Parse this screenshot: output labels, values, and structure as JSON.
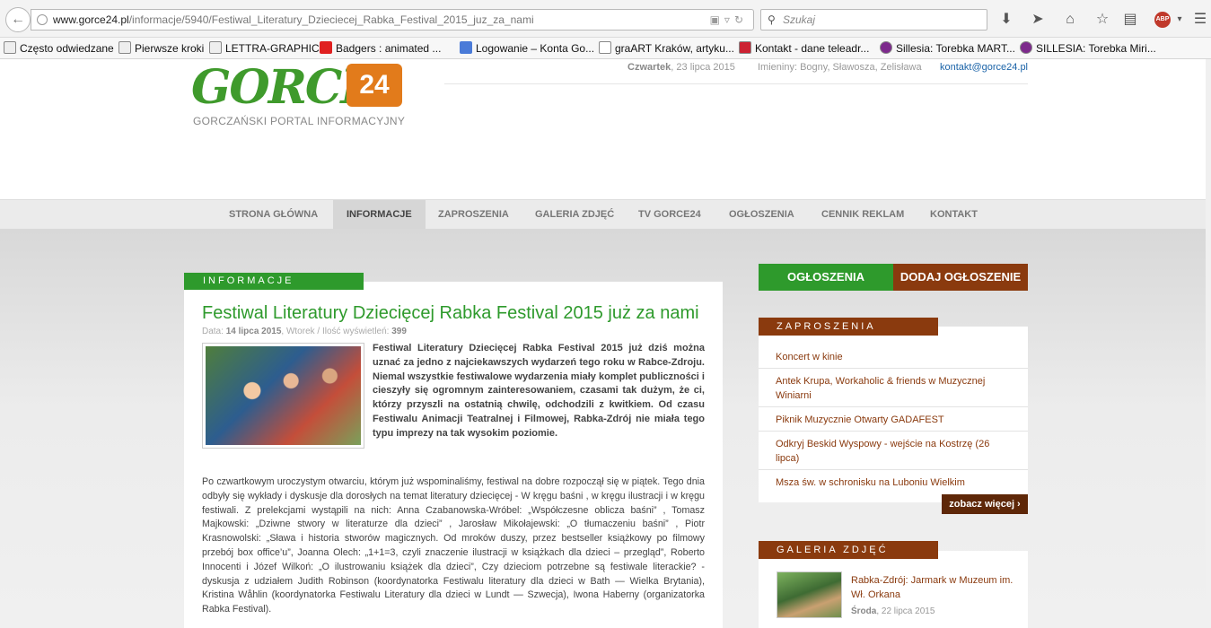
{
  "browser": {
    "url_host": "www.gorce24.pl",
    "url_path": "/informacje/5940/Festiwal_Literatury_Dzieciecej_Rabka_Festival_2015_juz_za_nami",
    "search_placeholder": "Szukaj",
    "abp_label": "ABP"
  },
  "bookmarks": [
    "Często odwiedzane",
    "Pierwsze kroki",
    "LETTRA-GRAPHIC",
    "Badgers : animated ...",
    "Logowanie – Konta Go...",
    "graART Kraków, artyku...",
    "Kontakt - dane teleadr...",
    "Sillesia: Torebka MART...",
    "SILLESIA: Torebka Miri..."
  ],
  "header": {
    "logo_word": "GORCE",
    "logo_badge": "24",
    "logo_tagline": "GORCZAŃSKI PORTAL INFORMACYJNY",
    "day": "Czwartek",
    "date": ", 23 lipca 2015",
    "nameday": "Imieniny: Bogny, Sławosza, Zelisława",
    "email": "kontakt@gorce24.pl"
  },
  "menu": [
    "STRONA GŁÓWNA",
    "INFORMACJE",
    "ZAPROSZENIA",
    "GALERIA ZDJĘĆ",
    "TV GORCE24",
    "OGŁOSZENIA",
    "CENNIK REKLAM",
    "KONTAKT"
  ],
  "article": {
    "section_label": "INFORMACJE",
    "title": "Festiwal Literatury Dziecięcej Rabka Festival 2015 już za nami",
    "meta_prefix": "Data: ",
    "meta_date": "14 lipca 2015",
    "meta_mid": ", Wtorek / Ilość wyświetleń: ",
    "meta_views": "399",
    "lead": "Festiwal Literatury Dziecięcej Rabka Festival 2015 już dziś można uznać za jedno z najciekawszych wydarzeń tego roku w Rabce-Zdroju. Niemal wszystkie festiwalowe wydarzenia miały komplet publiczności i cieszyły się ogromnym zainteresowaniem, czasami tak dużym, że ci, którzy przyszli na ostatnią chwilę, odchodzili z kwitkiem. Od czasu Festiwalu Animacji Teatralnej i Filmowej, Rabka-Zdrój nie miała tego typu imprezy na tak wysokim poziomie.",
    "body": "Po czwartkowym uroczystym otwarciu, którym już wspominaliśmy, festiwal na dobre rozpoczął się w piątek. Tego dnia odbyły się wykłady i dyskusje dla dorosłych na temat literatury dziecięcej - W kręgu baśni , w kręgu ilustracji i w kręgu festiwali. Z prelekcjami wystąpili na nich: Anna Czabanowska-Wróbel: „Współczesne oblicza baśni” , Tomasz Majkowski: „Dziwne stwory w literaturze dla dzieci” , Jarosław Mikołajewski: „O tłumaczeniu baśni” , Piotr Krasnowolski: „Sława i historia stworów magicznych. Od mroków duszy, przez bestseller książkowy po filmowy przebój box office’u”, Joanna Olech: „1+1=3, czyli znaczenie ilustracji w książkach dla dzieci – przegląd”, Roberto Innocenti i Józef Wilkoń: „O ilustrowaniu książek dla dzieci”, Czy dzieciom potrzebne są festiwale literackie? - dyskusja z udziałem Judith Robinson (koordynatorka Festiwalu literatury dla dzieci w Bath — Wielka Brytania), Kristina Wåhlin (koordynatorka Festiwalu Literatury dla dzieci w Lundt — Szwecja), Iwona Haberny (organizatorka Rabka Festival)."
  },
  "sidebar": {
    "ads_label": "OGŁOSZENIA",
    "ads_add_label": "DODAJ OGŁOSZENIE",
    "invitations_label": "ZAPROSZENIA",
    "invitations": [
      "Koncert w kinie",
      "Antek Krupa, Workaholic & friends w Muzycznej Winiarni",
      "Piknik Muzycznie Otwarty GADAFEST",
      "Odkryj Beskid Wyspowy - wejście na Kostrzę (26 lipca)",
      "Msza św. w schronisku na Luboniu Wielkim"
    ],
    "more_label": "zobacz więcej ›",
    "gallery_label": "GALERIA ZDJĘĆ",
    "gallery_title": "Rabka-Zdrój: Jarmark w Muzeum im. Wł. Orkana",
    "gallery_day": "Środa",
    "gallery_date": ", 22 lipca 2015"
  }
}
